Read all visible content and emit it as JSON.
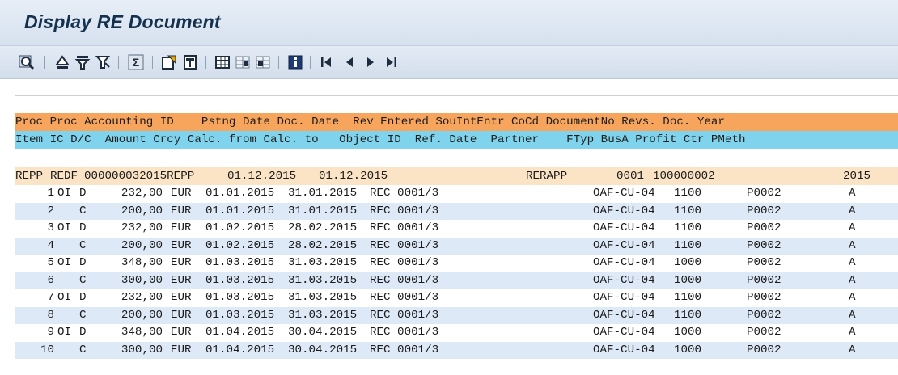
{
  "window": {
    "title": "Display RE Document"
  },
  "toolbar": {
    "buttons": [
      {
        "name": "details-icon"
      },
      {
        "name": "sort-ascending-icon"
      },
      {
        "name": "filter-icon"
      },
      {
        "name": "delete-filter-icon"
      },
      {
        "name": "total-icon"
      },
      {
        "name": "export-icon"
      },
      {
        "name": "print-preview-icon"
      },
      {
        "name": "layout-icon"
      },
      {
        "name": "choose-layout-icon"
      },
      {
        "name": "save-layout-icon"
      },
      {
        "name": "information-icon"
      },
      {
        "name": "first-page-icon"
      },
      {
        "name": "previous-page-icon"
      },
      {
        "name": "next-page-icon"
      },
      {
        "name": "last-page-icon"
      }
    ]
  },
  "header": {
    "line1": "Proc Proc Accounting ID    Pstng Date Doc. Date  Rev Entered SouIntEntr CoCd DocumentNo Revs. Doc. Year",
    "line2": "Item IC D/C  Amount Crcy Calc. from Calc. to   Object ID  Ref. Date  Partner    FTyp BusA Profit Ctr PMeth"
  },
  "summary": {
    "proc": "REPP",
    "proc2": "REDF",
    "accounting_id": "000000032015REPP",
    "posting_date": "01.12.2015",
    "doc_date": "01.12.2015",
    "entered": "RERAPP",
    "cocd": "0001",
    "document_no": "100000002",
    "year": "2015"
  },
  "rows": [
    {
      "item": "1",
      "ic": "OI",
      "dc": "D",
      "amount": "232,00",
      "crcy": "EUR",
      "from": "01.01.2015",
      "to": "31.01.2015",
      "object": "REC 0001/3",
      "partner": "OAF-CU-04",
      "busa": "1100",
      "profit": "P0002",
      "pmeth": "A"
    },
    {
      "item": "2",
      "ic": "",
      "dc": "C",
      "amount": "200,00",
      "crcy": "EUR",
      "from": "01.01.2015",
      "to": "31.01.2015",
      "object": "REC 0001/3",
      "partner": "OAF-CU-04",
      "busa": "1100",
      "profit": "P0002",
      "pmeth": "A"
    },
    {
      "item": "3",
      "ic": "OI",
      "dc": "D",
      "amount": "232,00",
      "crcy": "EUR",
      "from": "01.02.2015",
      "to": "28.02.2015",
      "object": "REC 0001/3",
      "partner": "OAF-CU-04",
      "busa": "1100",
      "profit": "P0002",
      "pmeth": "A"
    },
    {
      "item": "4",
      "ic": "",
      "dc": "C",
      "amount": "200,00",
      "crcy": "EUR",
      "from": "01.02.2015",
      "to": "28.02.2015",
      "object": "REC 0001/3",
      "partner": "OAF-CU-04",
      "busa": "1100",
      "profit": "P0002",
      "pmeth": "A"
    },
    {
      "item": "5",
      "ic": "OI",
      "dc": "D",
      "amount": "348,00",
      "crcy": "EUR",
      "from": "01.03.2015",
      "to": "31.03.2015",
      "object": "REC 0001/3",
      "partner": "OAF-CU-04",
      "busa": "1000",
      "profit": "P0002",
      "pmeth": "A"
    },
    {
      "item": "6",
      "ic": "",
      "dc": "C",
      "amount": "300,00",
      "crcy": "EUR",
      "from": "01.03.2015",
      "to": "31.03.2015",
      "object": "REC 0001/3",
      "partner": "OAF-CU-04",
      "busa": "1000",
      "profit": "P0002",
      "pmeth": "A"
    },
    {
      "item": "7",
      "ic": "OI",
      "dc": "D",
      "amount": "232,00",
      "crcy": "EUR",
      "from": "01.03.2015",
      "to": "31.03.2015",
      "object": "REC 0001/3",
      "partner": "OAF-CU-04",
      "busa": "1100",
      "profit": "P0002",
      "pmeth": "A"
    },
    {
      "item": "8",
      "ic": "",
      "dc": "C",
      "amount": "200,00",
      "crcy": "EUR",
      "from": "01.03.2015",
      "to": "31.03.2015",
      "object": "REC 0001/3",
      "partner": "OAF-CU-04",
      "busa": "1100",
      "profit": "P0002",
      "pmeth": "A"
    },
    {
      "item": "9",
      "ic": "OI",
      "dc": "D",
      "amount": "348,00",
      "crcy": "EUR",
      "from": "01.04.2015",
      "to": "30.04.2015",
      "object": "REC 0001/3",
      "partner": "OAF-CU-04",
      "busa": "1000",
      "profit": "P0002",
      "pmeth": "A"
    },
    {
      "item": "10",
      "ic": "",
      "dc": "C",
      "amount": "300,00",
      "crcy": "EUR",
      "from": "01.04.2015",
      "to": "30.04.2015",
      "object": "REC 0001/3",
      "partner": "OAF-CU-04",
      "busa": "1000",
      "profit": "P0002",
      "pmeth": "A"
    }
  ],
  "colors": {
    "header1": "#f7a45c",
    "header2": "#7fd3ec",
    "summary": "#fbe3c6",
    "row_alt": "#dde9f6",
    "row": "#ffffff"
  }
}
